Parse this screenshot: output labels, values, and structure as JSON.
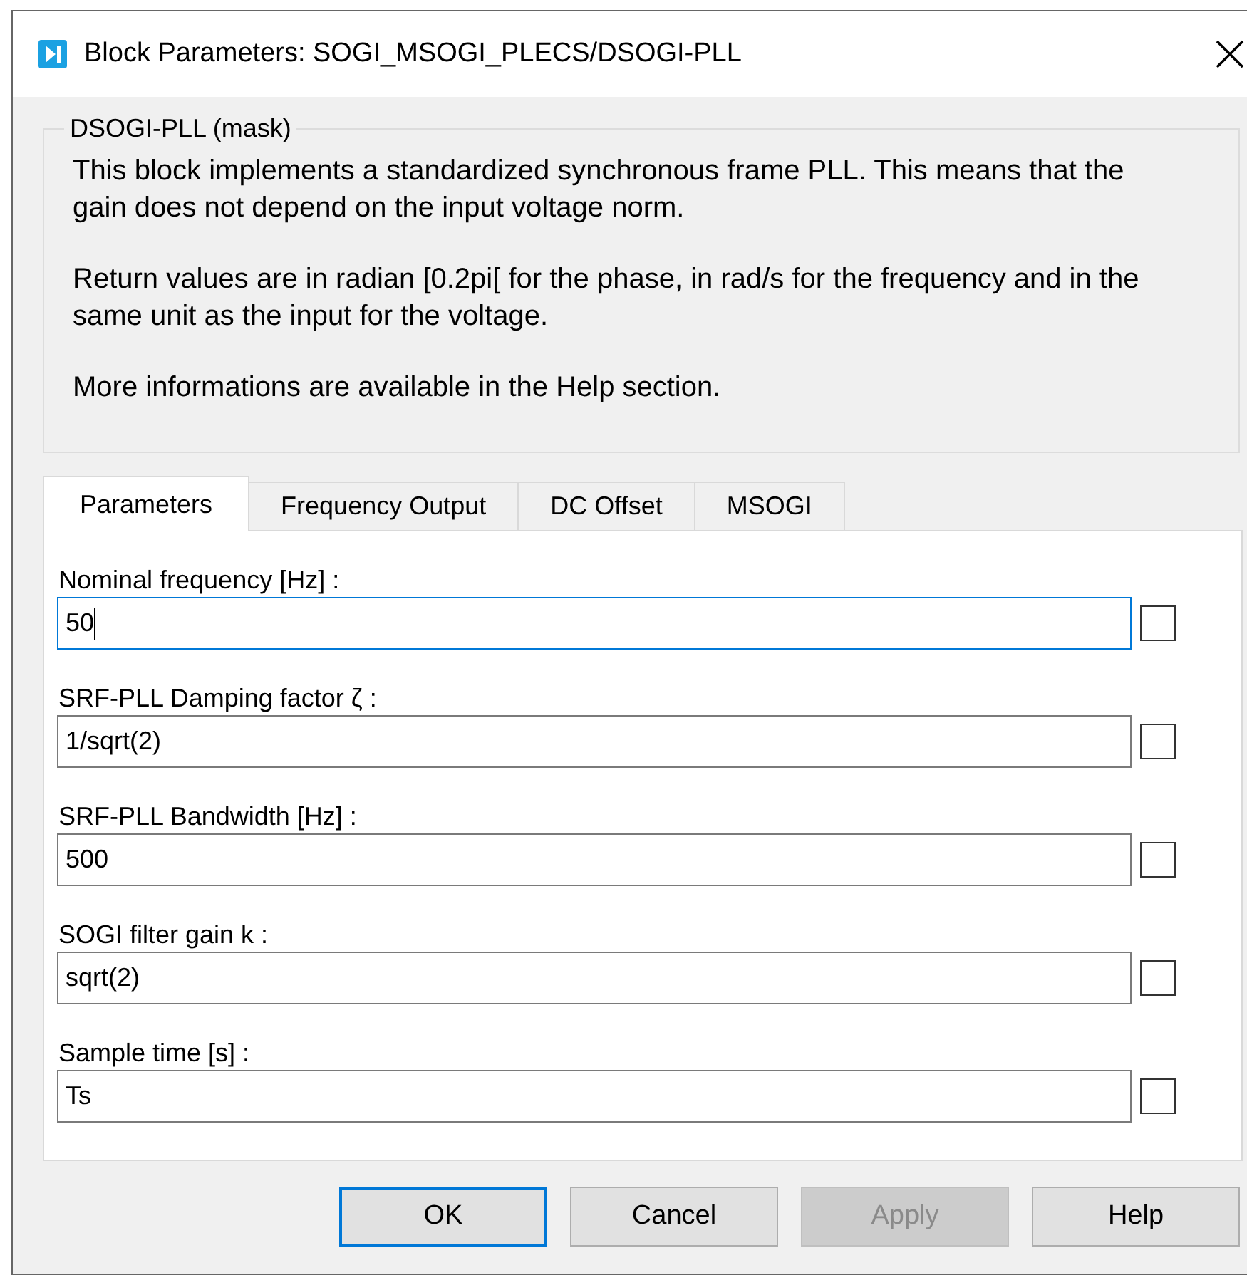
{
  "window": {
    "title": "Block Parameters: SOGI_MSOGI_PLECS/DSOGI-PLL"
  },
  "mask": {
    "title": "DSOGI-PLL (mask)",
    "paragraphs": [
      "This block implements a standardized synchronous frame PLL. This means that the gain does not depend on the input voltage norm.",
      "Return values are in radian [0.2pi[ for the phase, in rad/s for the frequency and in the same unit as the input for the voltage.",
      "More informations are available in the Help section."
    ]
  },
  "tabs": [
    {
      "label": "Parameters",
      "selected": true
    },
    {
      "label": "Frequency Output",
      "selected": false
    },
    {
      "label": "DC Offset",
      "selected": false
    },
    {
      "label": "MSOGI",
      "selected": false
    }
  ],
  "fields": [
    {
      "label": "Nominal frequency [Hz] :",
      "value": "50",
      "focused": true,
      "checked": false
    },
    {
      "label": "SRF-PLL Damping factor ζ :",
      "value": "1/sqrt(2)",
      "focused": false,
      "checked": false
    },
    {
      "label": "SRF-PLL Bandwidth [Hz] :",
      "value": "500",
      "focused": false,
      "checked": false
    },
    {
      "label": "SOGI filter gain k :",
      "value": "sqrt(2)",
      "focused": false,
      "checked": false
    },
    {
      "label": "Sample time [s] :",
      "value": "Ts",
      "focused": false,
      "checked": false
    }
  ],
  "buttons": [
    {
      "label": "OK",
      "default": true,
      "disabled": false
    },
    {
      "label": "Cancel",
      "default": false,
      "disabled": false
    },
    {
      "label": "Apply",
      "default": false,
      "disabled": true
    },
    {
      "label": "Help",
      "default": false,
      "disabled": false
    }
  ]
}
